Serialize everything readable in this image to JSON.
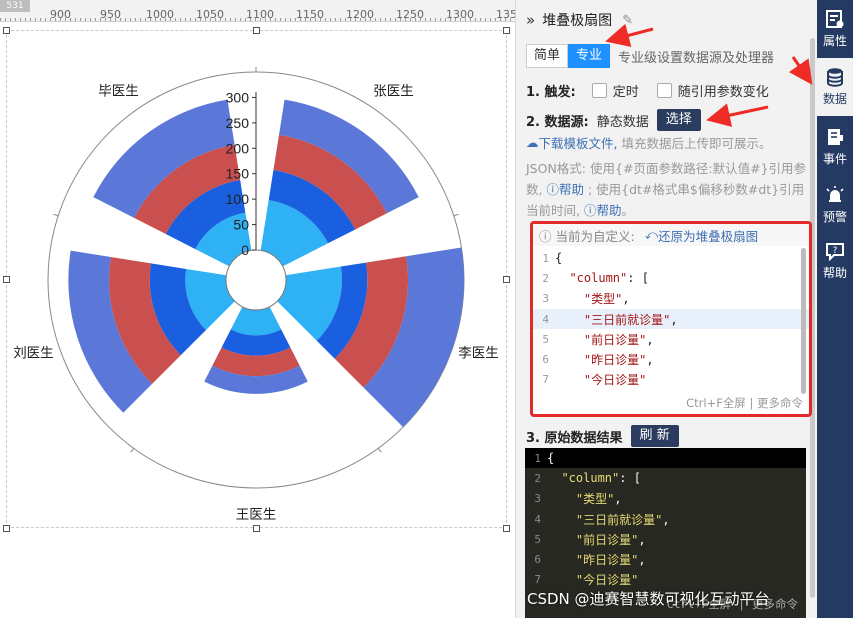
{
  "ruler": {
    "badge": "531",
    "labels": [
      "900",
      "950",
      "1000",
      "1050",
      "1100",
      "1150",
      "1200",
      "1250",
      "1300",
      "135"
    ]
  },
  "chart_data": {
    "type": "polar-stacked-bar",
    "categories": [
      "张医生",
      "李医生",
      "王医生",
      "刘医生",
      "毕医生"
    ],
    "radius_ticks": [
      "0",
      "50",
      "100",
      "150",
      "200",
      "250",
      "300"
    ],
    "rmax": 350,
    "series": [
      {
        "values": [
          100,
          110,
          50,
          80,
          75
        ],
        "color": "#2fb2f5"
      },
      {
        "values": [
          60,
          50,
          40,
          70,
          65
        ],
        "color": "#1a5fe0"
      },
      {
        "values": [
          70,
          80,
          40,
          80,
          70
        ],
        "color": "#c9504f"
      },
      {
        "values": [
          70,
          110,
          35,
          80,
          90
        ],
        "color": "#5b78d9"
      }
    ]
  },
  "panel": {
    "title": "堆叠极扇图",
    "collapse_icon": "»",
    "mode_simple": "简单",
    "mode_pro": "专业",
    "mode_desc": "专业级设置数据源及处理器",
    "trigger_label": "1. 触发:",
    "trigger_timer": "定时",
    "trigger_param": "随引用参数变化",
    "source_label": "2. 数据源:",
    "source_value": "静态数据",
    "select_btn": "选择",
    "download_link": "下载模板文件,",
    "download_tip": "填充数据后上传即可展示。",
    "json_help_1": "JSON格式: 使用{#页面参数路径:默认值#}引用参数,",
    "help_link_1": "帮助",
    "json_help_2": "; 使用{dt#格式串$偏移秒数#dt}引用当前时间,",
    "help_link_2": "帮助",
    "json_help_end": "。",
    "custom_notice": "当前为自定义:",
    "restore_link": "还原为堆叠极扇图",
    "editor_lines": [
      {
        "n": "1",
        "t": "{"
      },
      {
        "n": "2",
        "t": "  \"column\": ["
      },
      {
        "n": "3",
        "t": "    \"类型\","
      },
      {
        "n": "4",
        "t": "    \"三日前就诊量\","
      },
      {
        "n": "5",
        "t": "    \"前日诊量\","
      },
      {
        "n": "6",
        "t": "    \"昨日诊量\","
      },
      {
        "n": "7",
        "t": "    \"今日诊量\""
      }
    ],
    "editor_foot": "Ctrl+F全屏 | 更多命令",
    "result_label": "3. 原始数据结果",
    "refresh_btn": "刷 新",
    "result_lines": [
      {
        "n": "1",
        "t": "{"
      },
      {
        "n": "2",
        "t": "  \"column\": ["
      },
      {
        "n": "3",
        "t": "    \"类型\","
      },
      {
        "n": "4",
        "t": "    \"三日前就诊量\","
      },
      {
        "n": "5",
        "t": "    \"前日诊量\","
      },
      {
        "n": "6",
        "t": "    \"昨日诊量\","
      },
      {
        "n": "7",
        "t": "    \"今日诊量\""
      }
    ],
    "result_foot": "Ctrl+F全屏 | 更多命令"
  },
  "iconbar": {
    "items": [
      {
        "label": "属性",
        "icon": "properties-icon"
      },
      {
        "label": "数据",
        "icon": "database-icon"
      },
      {
        "label": "事件",
        "icon": "event-icon"
      },
      {
        "label": "预警",
        "icon": "alarm-icon"
      },
      {
        "label": "帮助",
        "icon": "help-icon"
      }
    ]
  },
  "watermark": "CSDN @迪赛智慧数可视化互动平台",
  "colors": {
    "accent": "#1e90ff",
    "sidebar": "#243a63",
    "highlight_border": "#e32a2a",
    "arrow": "#ee2b24"
  }
}
